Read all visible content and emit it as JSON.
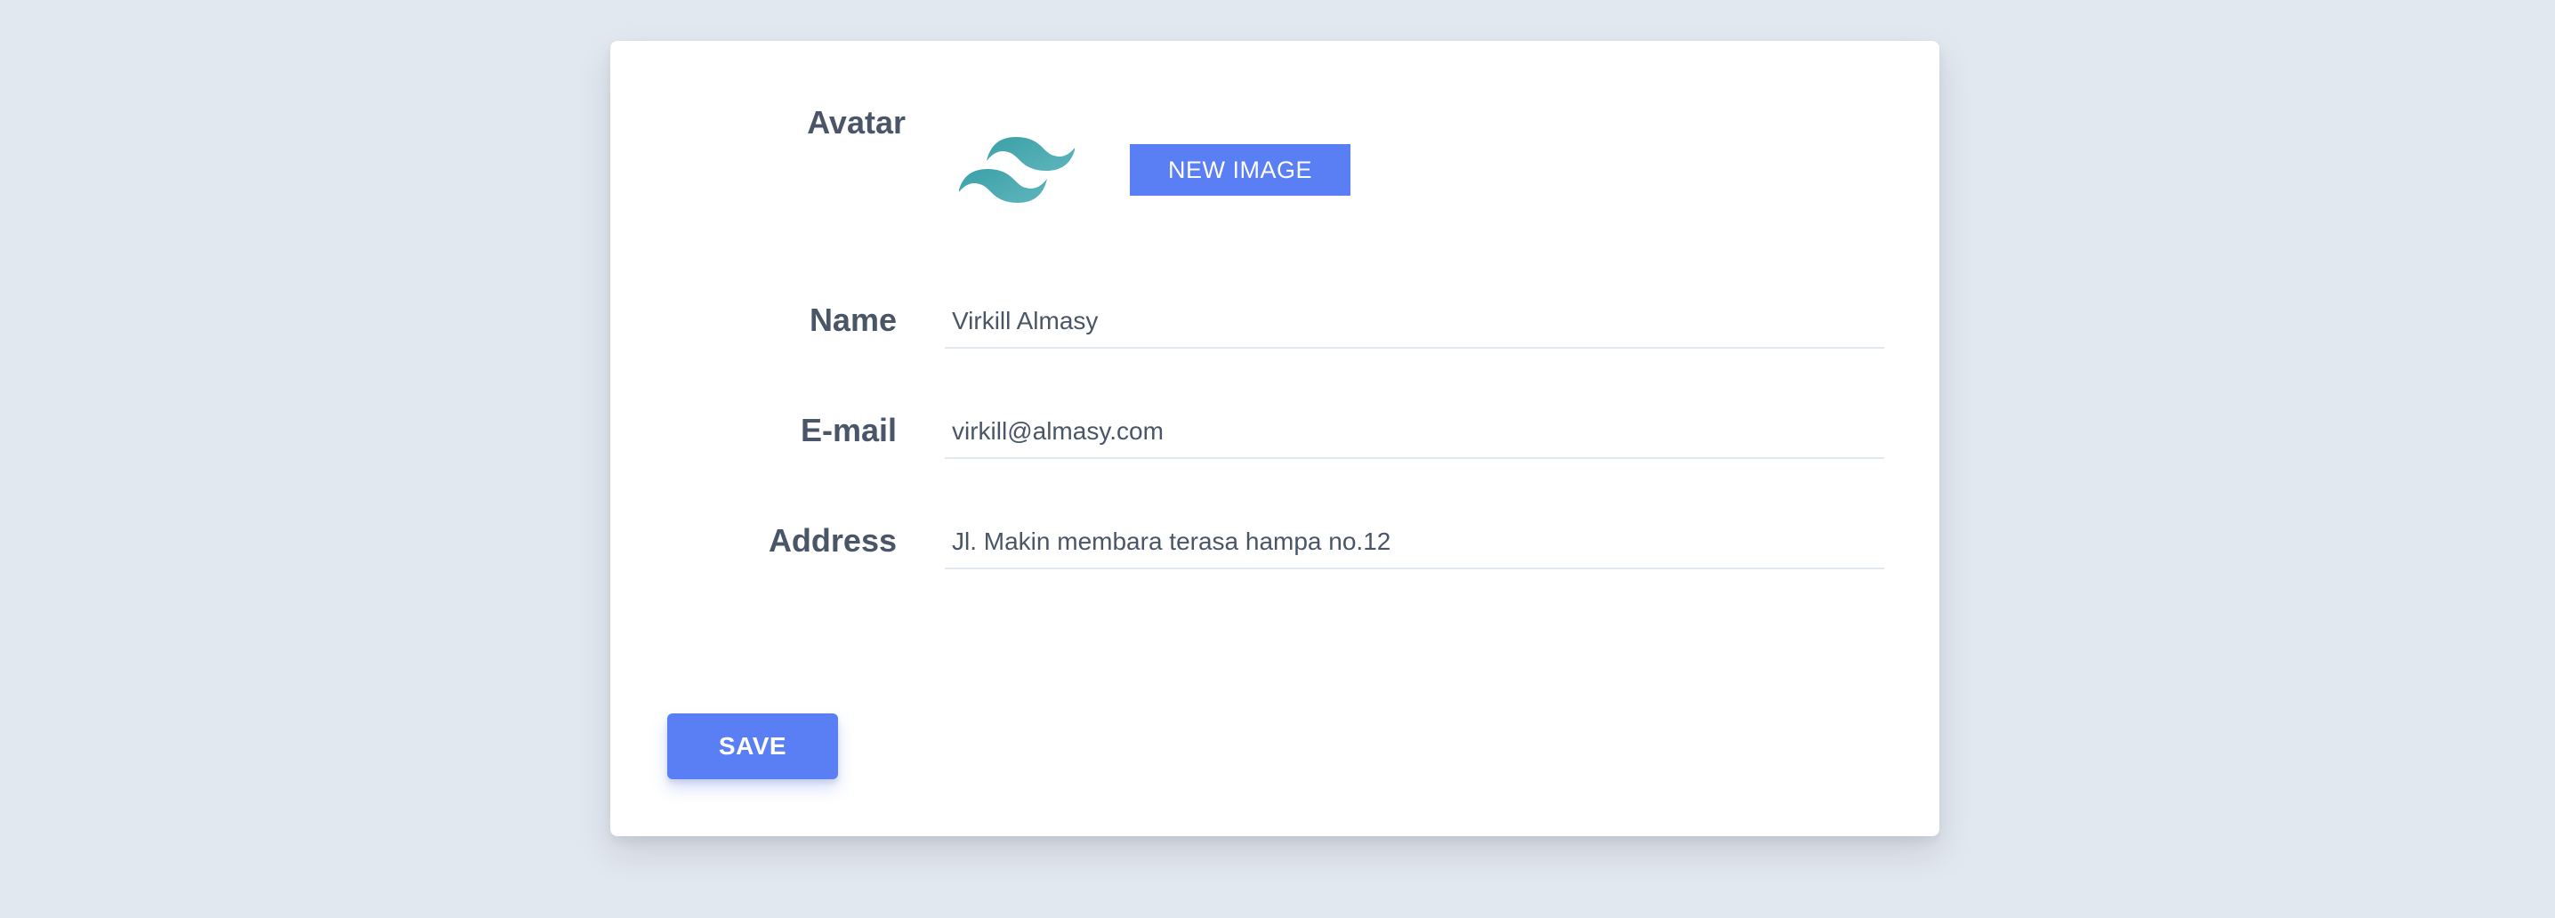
{
  "form": {
    "avatar_label": "Avatar",
    "avatar_logo_icon": "tailwind-logo-icon",
    "new_image_label": "NEW IMAGE",
    "name_label": "Name",
    "name_value": "Virkill Almasy",
    "email_label": "E-mail",
    "email_value": "virkill@almasy.com",
    "address_label": "Address",
    "address_value": "Jl. Makin membara terasa hampa no.12",
    "save_label": "SAVE"
  },
  "colors": {
    "background": "#e2e8f0",
    "card": "#ffffff",
    "accent": "#5a7ff5",
    "label_text": "#4a5568",
    "logo_teal": "#4fa8b0"
  }
}
